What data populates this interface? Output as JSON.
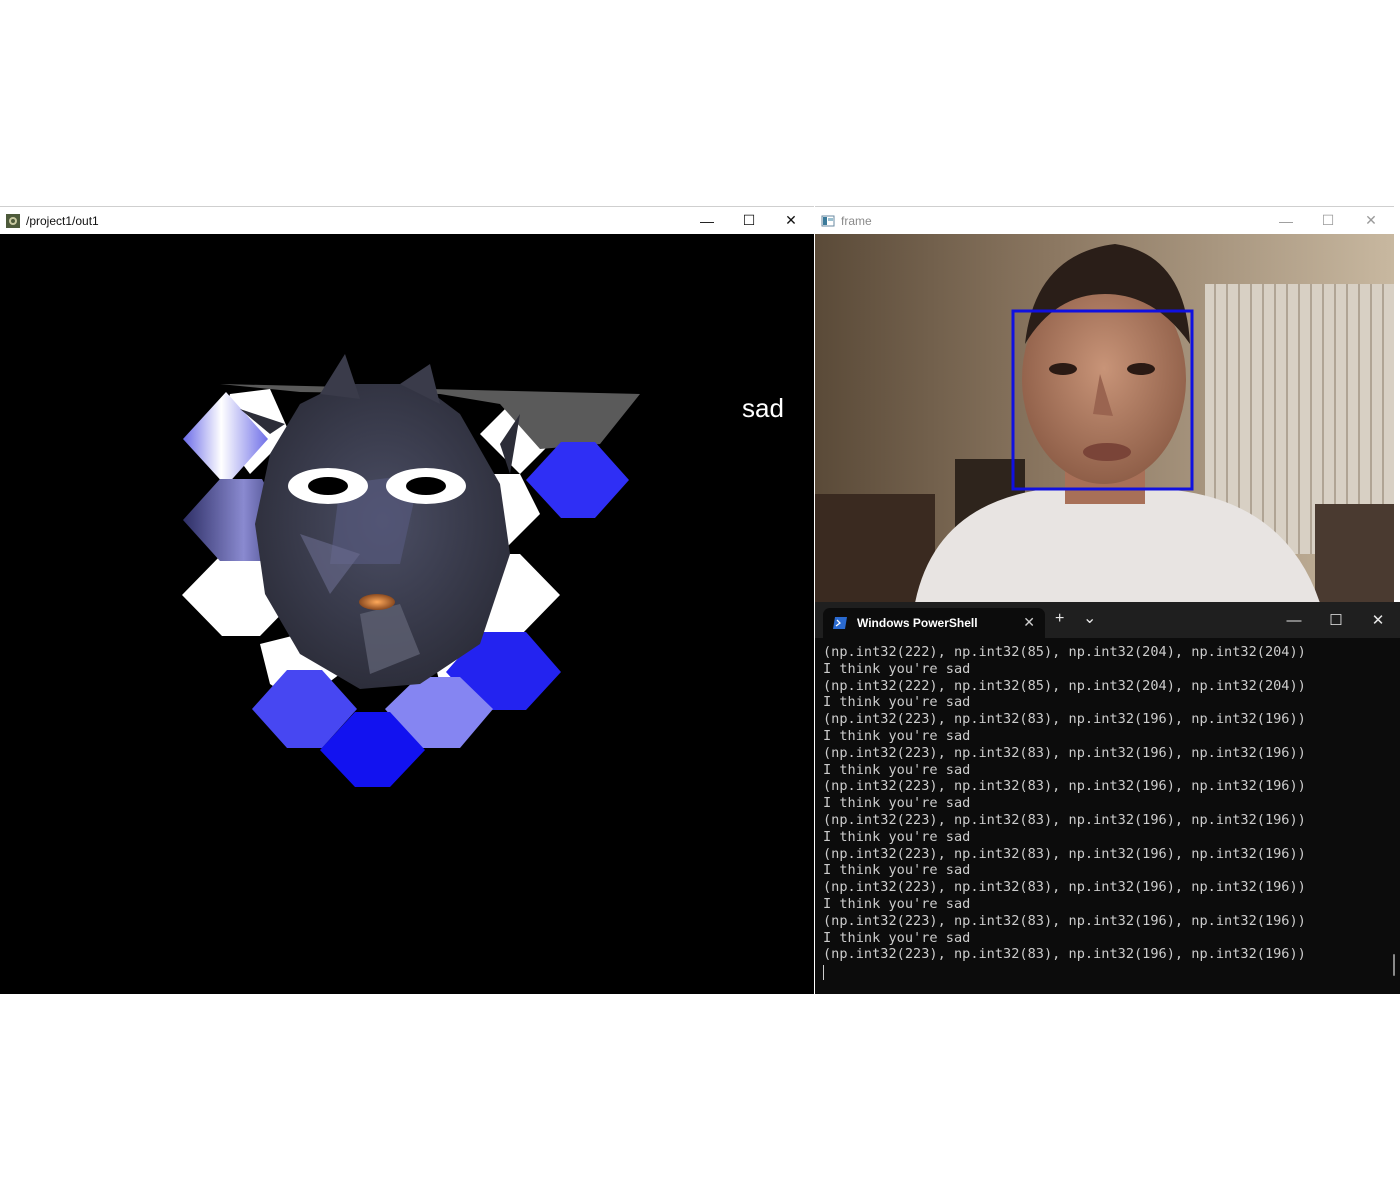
{
  "out1_window": {
    "title": "/project1/out1",
    "minimize": "—",
    "maximize": "☐",
    "close": "✕",
    "emotion_label": "sad"
  },
  "frame_window": {
    "title": "frame",
    "minimize": "—",
    "maximize": "☐",
    "close": "✕",
    "face_box_color": "#1010e0"
  },
  "powershell": {
    "tab_title": "Windows PowerShell",
    "tab_close": "✕",
    "new_tab": "+",
    "dropdown": "⌄",
    "minimize": "—",
    "maximize": "☐",
    "close": "✕",
    "lines": [
      "(np.int32(222), np.int32(85), np.int32(204), np.int32(204))",
      "I think you're sad",
      "(np.int32(222), np.int32(85), np.int32(204), np.int32(204))",
      "I think you're sad",
      "(np.int32(223), np.int32(83), np.int32(196), np.int32(196))",
      "I think you're sad",
      "(np.int32(223), np.int32(83), np.int32(196), np.int32(196))",
      "I think you're sad",
      "(np.int32(223), np.int32(83), np.int32(196), np.int32(196))",
      "I think you're sad",
      "(np.int32(223), np.int32(83), np.int32(196), np.int32(196))",
      "I think you're sad",
      "(np.int32(223), np.int32(83), np.int32(196), np.int32(196))",
      "I think you're sad",
      "(np.int32(223), np.int32(83), np.int32(196), np.int32(196))",
      "I think you're sad",
      "(np.int32(223), np.int32(83), np.int32(196), np.int32(196))",
      "I think you're sad",
      "(np.int32(223), np.int32(83), np.int32(196), np.int32(196))"
    ]
  },
  "colors": {
    "hex_blue": "#2f2ff5",
    "hex_light_blue": "#8585f2",
    "hex_white": "#ffffff",
    "face_dark": "#3a3c4e"
  }
}
